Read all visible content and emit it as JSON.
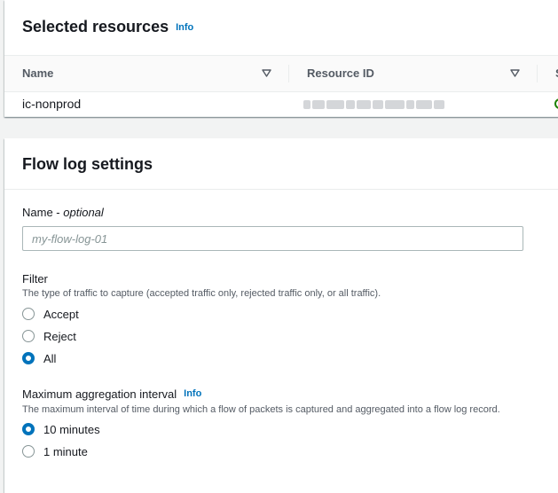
{
  "selected_resources": {
    "title": "Selected resources",
    "info_label": "Info",
    "columns": [
      {
        "label": "Name"
      },
      {
        "label": "Resource ID"
      },
      {
        "label": "S"
      }
    ],
    "rows": [
      {
        "name": "ic-nonprod"
      }
    ]
  },
  "flow_log": {
    "title": "Flow log settings",
    "name_field": {
      "label": "Name",
      "optional_suffix": "optional",
      "separator": " - ",
      "placeholder": "my-flow-log-01",
      "value": ""
    },
    "filter": {
      "label": "Filter",
      "description": "The type of traffic to capture (accepted traffic only, rejected traffic only, or all traffic).",
      "options": [
        {
          "label": "Accept",
          "checked": false
        },
        {
          "label": "Reject",
          "checked": false
        },
        {
          "label": "All",
          "checked": true
        }
      ]
    },
    "aggregation": {
      "label": "Maximum aggregation interval",
      "info_label": "Info",
      "description": "The maximum interval of time during which a flow of packets is captured and aggregated into a flow log record.",
      "options": [
        {
          "label": "10 minutes",
          "checked": true
        },
        {
          "label": "1 minute",
          "checked": false
        }
      ]
    }
  },
  "colors": {
    "accent": "#0073bb",
    "status_ok": "#1d8102",
    "background": "#f2f3f3"
  }
}
